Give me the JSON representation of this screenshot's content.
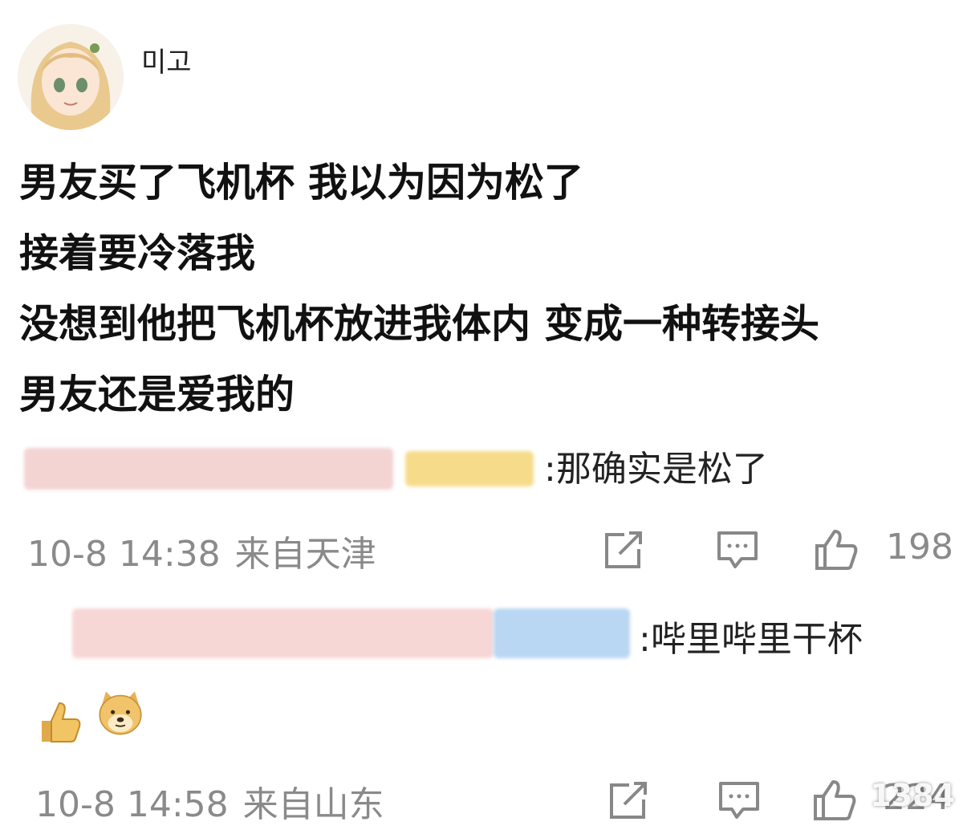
{
  "post": {
    "username": "미고",
    "lines": [
      "男友买了飞机杯 我以为因为松了",
      "接着要冷落我",
      "没想到他把飞机杯放进我体内 变成一种转接头",
      "男友还是爱我的"
    ]
  },
  "comments": [
    {
      "text": ":那确实是松了",
      "time": "10-8 14:38",
      "location": "来自天津",
      "likes": "198"
    },
    {
      "text": ":哔里哔里干杯",
      "time": "10-8 14:58",
      "location": "来自山东",
      "likes": "224"
    }
  ],
  "icons": [
    "share-icon",
    "comment-icon",
    "like-icon",
    "thumbs-up-emoji",
    "doge-emoji"
  ],
  "colors": {
    "meta_gray": "#8a8a8a",
    "blur_pink": "#f3c9c9",
    "blur_yellow": "#f6dc8a",
    "blur_blue": "#b9d6f3"
  },
  "watermark": "1384"
}
